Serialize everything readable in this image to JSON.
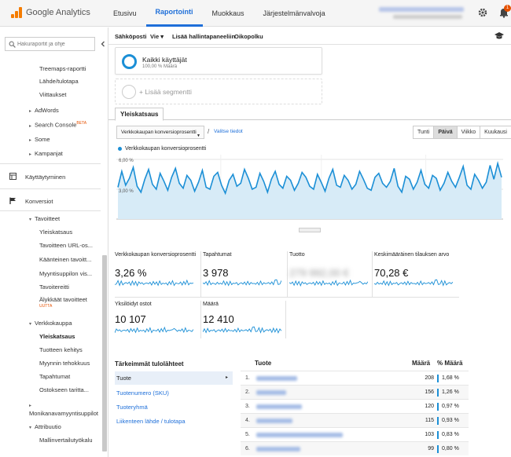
{
  "app": {
    "name": "Google Analytics",
    "brand_color": "#f57c00",
    "accent_color": "#1e6fd9",
    "chart_color": "#1b8fd6"
  },
  "topnav": {
    "items": [
      "Etusivu",
      "Raportointi",
      "Muokkaus",
      "Järjestelmänvalvoja"
    ],
    "active_index": 1
  },
  "notifications": {
    "count": "1"
  },
  "sidebar": {
    "search_placeholder": "Hakuraportit ja ohje",
    "items": [
      {
        "label": "Treemaps-raportti"
      },
      {
        "label": "Lähde/tulotapa"
      },
      {
        "label": "Viittaukset"
      },
      {
        "label": "AdWords"
      },
      {
        "label": "Search Console",
        "badge": "BETA"
      },
      {
        "label": "Some"
      },
      {
        "label": "Kampanjat"
      },
      {
        "label": "Käyttäytyminen"
      },
      {
        "label": "Konversiot"
      },
      {
        "label": "Tavoitteet"
      },
      {
        "label": "Yleiskatsaus"
      },
      {
        "label": "Tavoitteen URL-os..."
      },
      {
        "label": "Käänteinen tavoitt..."
      },
      {
        "label": "Myyntisuppilon vis..."
      },
      {
        "label": "Tavoitereitti"
      },
      {
        "label": "Älykkäät tavoitteet",
        "badge": "UUTTA"
      },
      {
        "label": "Verkkokauppa"
      },
      {
        "label": "Yleiskatsaus"
      },
      {
        "label": "Tuotteen kehitys"
      },
      {
        "label": "Myynnin tehokkuus"
      },
      {
        "label": "Tapahtumat"
      },
      {
        "label": "Ostokseen taritta..."
      },
      {
        "label": "Monikanavamyyntisuppilot"
      },
      {
        "label": "Attribuutio"
      },
      {
        "label": "Mallinvertailutyökalu"
      }
    ]
  },
  "toolbar": {
    "email": "Sähköposti",
    "export": "Vie",
    "add_dashboard": "Lisää hallintapaneeliin",
    "shortcut": "Oikopolku"
  },
  "segments": {
    "active_title": "Kaikki käyttäjät",
    "active_sub": "100,00 % Määrä",
    "add_label": "+ Lisää segmentti"
  },
  "tab": {
    "label": "Yleiskatsaus"
  },
  "controls": {
    "metric_select": "Verkkokaupan konversioprosentti",
    "slash": "/",
    "pick_metric": "Valitse tiedot",
    "time_buttons": [
      "Tunti",
      "Päivä",
      "Viikko",
      "Kuukausi"
    ],
    "time_active": 1
  },
  "chart_data": {
    "type": "line",
    "series": [
      {
        "name": "Verkkokaupan konversioprosentti",
        "values": [
          3.2,
          4.8,
          3.4,
          4.1,
          5.2,
          3.3,
          2.7,
          4.0,
          5.0,
          3.5,
          3.0,
          4.6,
          3.8,
          2.9,
          4.2,
          5.1,
          3.6,
          3.1,
          4.4,
          3.9,
          2.8,
          3.7,
          4.9,
          3.2,
          3.0,
          4.3,
          4.7,
          3.4,
          2.6,
          3.9,
          4.5,
          3.3,
          3.6,
          5.0,
          4.1,
          3.0,
          3.2,
          4.6,
          3.8,
          2.7,
          4.0,
          4.8,
          3.5,
          3.1,
          4.3,
          3.9,
          2.9,
          3.6,
          4.7,
          4.2,
          3.3,
          3.0,
          4.5,
          3.7,
          2.8,
          4.1,
          5.0,
          3.4,
          3.2,
          4.4,
          3.9,
          3.0,
          3.5,
          4.8,
          4.0,
          3.1,
          2.9,
          4.2,
          4.6,
          3.6,
          3.2,
          3.8,
          5.1,
          3.3,
          2.7,
          4.3,
          4.0,
          3.0,
          3.7,
          4.9,
          3.5,
          3.1,
          4.4,
          4.1,
          2.9,
          3.6,
          4.7,
          3.8,
          3.2,
          4.2,
          5.3,
          3.4,
          3.0,
          4.5,
          3.9,
          3.1,
          3.7,
          5.4,
          4.0,
          5.6,
          4.2
        ]
      }
    ],
    "y_ticks": [
      "6,00 %",
      "3,00 %"
    ],
    "ylim": [
      0,
      6
    ],
    "grid": true
  },
  "kpis": [
    {
      "label": "Verkkokaupan konversioprosentti",
      "value": "3,26 %"
    },
    {
      "label": "Tapahtumat",
      "value": "3 978"
    },
    {
      "label": "Tuotto",
      "value": "279 992,00 €"
    },
    {
      "label": "Keskimääräinen tilauksen arvo",
      "value": "70,28 €"
    },
    {
      "label": "Yksilöidyt ostot",
      "value": "10 107"
    },
    {
      "label": "Määrä",
      "value": "12 410"
    }
  ],
  "sources": {
    "header": "Tärkeimmät tulolähteet",
    "items": [
      "Tuote",
      "Tuotenumero (SKU)",
      "Tuoteryhmä",
      "Liikenteen lähde / tulotapa"
    ],
    "active_index": 0
  },
  "table": {
    "headers": [
      "Tuote",
      "Määrä",
      "% Määrä"
    ],
    "rows": [
      {
        "n": "1.",
        "value": "208",
        "pct": "1,68 %"
      },
      {
        "n": "2.",
        "value": "156",
        "pct": "1,26 %"
      },
      {
        "n": "3.",
        "value": "120",
        "pct": "0,97 %"
      },
      {
        "n": "4.",
        "value": "115",
        "pct": "0,93 %"
      },
      {
        "n": "5.",
        "value": "103",
        "pct": "0,83 %"
      },
      {
        "n": "6.",
        "value": "99",
        "pct": "0,80 %"
      }
    ]
  }
}
